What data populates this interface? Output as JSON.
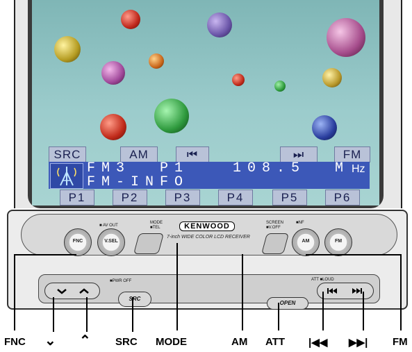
{
  "screen": {
    "softkeys": [
      "SRC",
      "AM",
      "⏮",
      "⏭",
      "FM"
    ],
    "freq_line": "FM3  P1   108.5  M",
    "freq_unit": "Hz",
    "info_line": "FM-INFO",
    "presets": [
      "P1",
      "P2",
      "P3",
      "P4",
      "P5",
      "P6"
    ],
    "icons": [
      "antenna-icon",
      "prev-track-icon",
      "next-track-icon"
    ]
  },
  "panel": {
    "brand": "KENWOOD",
    "tagline": "7-inch WIDE COLOR LCD RECEIVER",
    "av_out": "■ AV OUT",
    "mode_label": "MODE",
    "tel_label": "■TEL",
    "screen_label": "SCREEN",
    "voff_label": "■V.OFF",
    "nf_label": "■NF",
    "pwr_off": "■PWR OFF",
    "att_loud": "ATT ■LOUD",
    "buttons": {
      "fnc": "FNC",
      "vsel": "V.SEL",
      "am": "AM",
      "fm": "FM",
      "src": "SRC",
      "open": "OPEN"
    }
  },
  "callouts": {
    "fnc": "FNC",
    "down": "⌄",
    "up": "⌃",
    "src": "SRC",
    "mode": "MODE",
    "am": "AM",
    "att": "ATT",
    "prev": "|◀◀",
    "next": "▶▶|",
    "fm": "FM"
  },
  "colors": {
    "screen_bg": "#9ccccc",
    "info_panel": "#3c58b8",
    "softkey_bg": "#b9c2d8"
  }
}
